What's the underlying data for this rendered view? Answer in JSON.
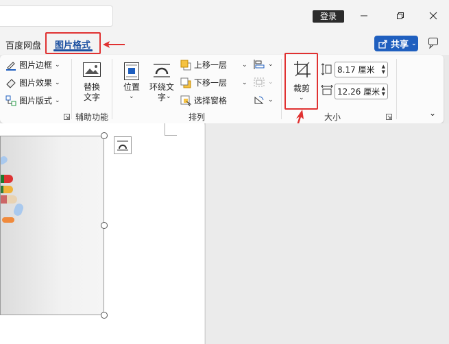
{
  "titlebar": {
    "login_label": "登录",
    "minimize_icon": "minimize-icon",
    "restore_icon": "restore-icon",
    "close_icon": "close-icon"
  },
  "tabs": {
    "baidu_label": "百度网盘",
    "picture_format_label": "图片格式",
    "share_label": "共享"
  },
  "ribbon": {
    "picture_border": "图片边框",
    "picture_effects": "图片效果",
    "picture_layout": "图片版式",
    "alt_text_line1": "替换",
    "alt_text_line2": "文字",
    "accessibility_group": "辅助功能",
    "position_label": "位置",
    "wrap_text_line1": "环绕文",
    "wrap_text_line2": "字",
    "bring_forward": "上移一层",
    "send_backward": "下移一层",
    "selection_pane": "选择窗格",
    "arrange_group": "排列",
    "crop_label": "裁剪",
    "height_value": "8.17 厘米",
    "width_value": "12.26 厘米",
    "size_group": "大小"
  },
  "colors": {
    "accent_blue": "#1f5fbf",
    "annotation_red": "#e03131"
  }
}
